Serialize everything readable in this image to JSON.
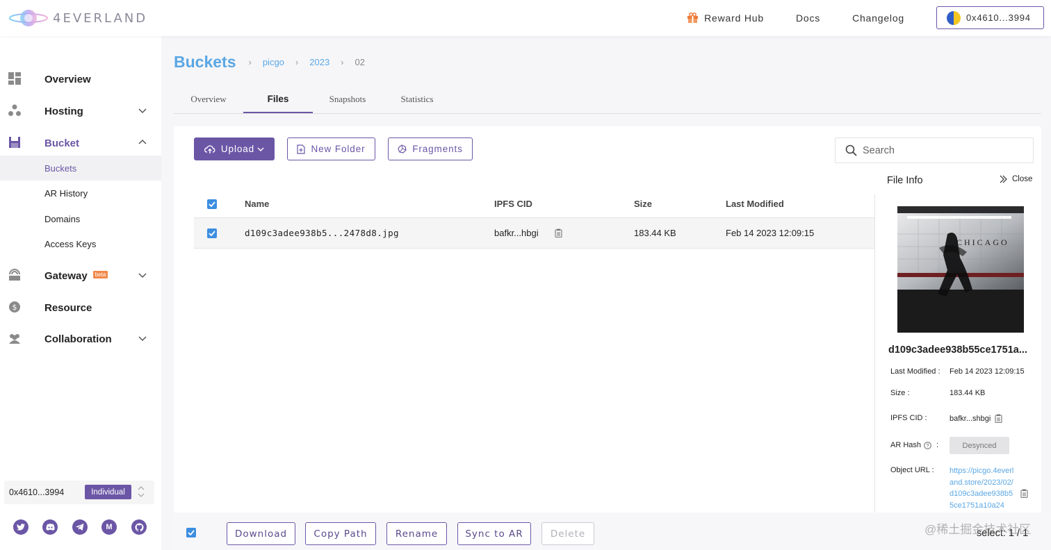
{
  "topbar": {
    "logo_text": "4EVERLAND",
    "reward_hub": "Reward Hub",
    "docs": "Docs",
    "changelog": "Changelog",
    "wallet": "0x4610...3994"
  },
  "sidebar": {
    "items": [
      {
        "label": "Overview"
      },
      {
        "label": "Hosting"
      },
      {
        "label": "Bucket"
      },
      {
        "label": "Gateway",
        "badge": "beta"
      },
      {
        "label": "Resource"
      },
      {
        "label": "Collaboration"
      }
    ],
    "bucket_sub": [
      "Buckets",
      "AR History",
      "Domains",
      "Access Keys"
    ],
    "account": "0x4610...3994",
    "account_type": "Individual",
    "socials": [
      "twitter-icon",
      "discord-icon",
      "telegram-icon",
      "medium-icon",
      "github-icon"
    ]
  },
  "breadcrumb": {
    "title": "Buckets",
    "parts": [
      "picgo",
      "2023",
      "02"
    ]
  },
  "tabs": [
    "Overview",
    "Files",
    "Snapshots",
    "Statistics"
  ],
  "toolbar": {
    "upload": "Upload",
    "new_folder": "New Folder",
    "fragments": "Fragments",
    "search_placeholder": "Search"
  },
  "table": {
    "columns": [
      "Name",
      "IPFS CID",
      "Size",
      "Last Modified"
    ],
    "rows": [
      {
        "name": "d109c3adee938b5...2478d8.jpg",
        "cid": "bafkr...hbgi",
        "size": "183.44 KB",
        "modified": "Feb 14 2023 12:09:15"
      }
    ]
  },
  "file_info": {
    "title": "File Info",
    "close": "Close",
    "image_text": "CHICAGO",
    "filename": "d109c3adee938b55ce1751a...",
    "labels": {
      "modified": "Last Modified :",
      "size": "Size :",
      "cid": "IPFS CID :",
      "ar_hash": "AR Hash",
      "ar_colon": ":",
      "object_url": "Object URL :"
    },
    "modified": "Feb 14 2023 12:09:15",
    "size": "183.44 KB",
    "cid": "bafkr...shbgi",
    "ar_status": "Desynced",
    "object_url": "https://picgo.4everland.store/2023/02/d109c3adee938b55ce1751a10a24"
  },
  "actions": {
    "download": "Download",
    "copy_path": "Copy Path",
    "rename": "Rename",
    "sync": "Sync to AR",
    "delete": "Delete",
    "selected": "select: 1 / 1",
    "watermark": "@稀土掘金技术社区"
  },
  "colors": {
    "accent": "#6b56a6",
    "link": "#5aa7e4",
    "checkbox": "#3d8ee0"
  }
}
